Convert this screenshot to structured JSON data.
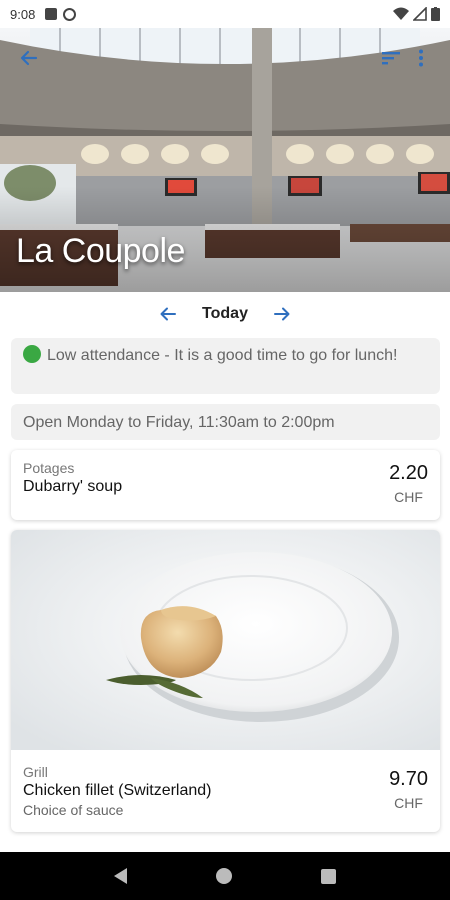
{
  "status_bar": {
    "time": "9:08"
  },
  "hero": {
    "title": "La Coupole"
  },
  "date_nav": {
    "label": "Today"
  },
  "attendance": {
    "text": "Low attendance - It is a good time to go for lunch!"
  },
  "hours": {
    "text": "Open Monday to Friday, 11:30am to 2:00pm"
  },
  "menu": [
    {
      "category": "Potages",
      "name": "Dubarry' soup",
      "description": "",
      "price": "2.20",
      "currency": "CHF"
    },
    {
      "category": "Grill",
      "name": "Chicken fillet (Switzerland)",
      "description": "Choice of sauce",
      "price": "9.70",
      "currency": "CHF"
    }
  ],
  "colors": {
    "accent": "#2f6fbe",
    "status_green": "#3aa843",
    "info_bg": "#f1f1f1"
  },
  "icons": [
    "back-arrow-icon",
    "sort-icon",
    "more-vert-icon",
    "arrow-left-icon",
    "arrow-right-icon",
    "green-dot-icon"
  ]
}
